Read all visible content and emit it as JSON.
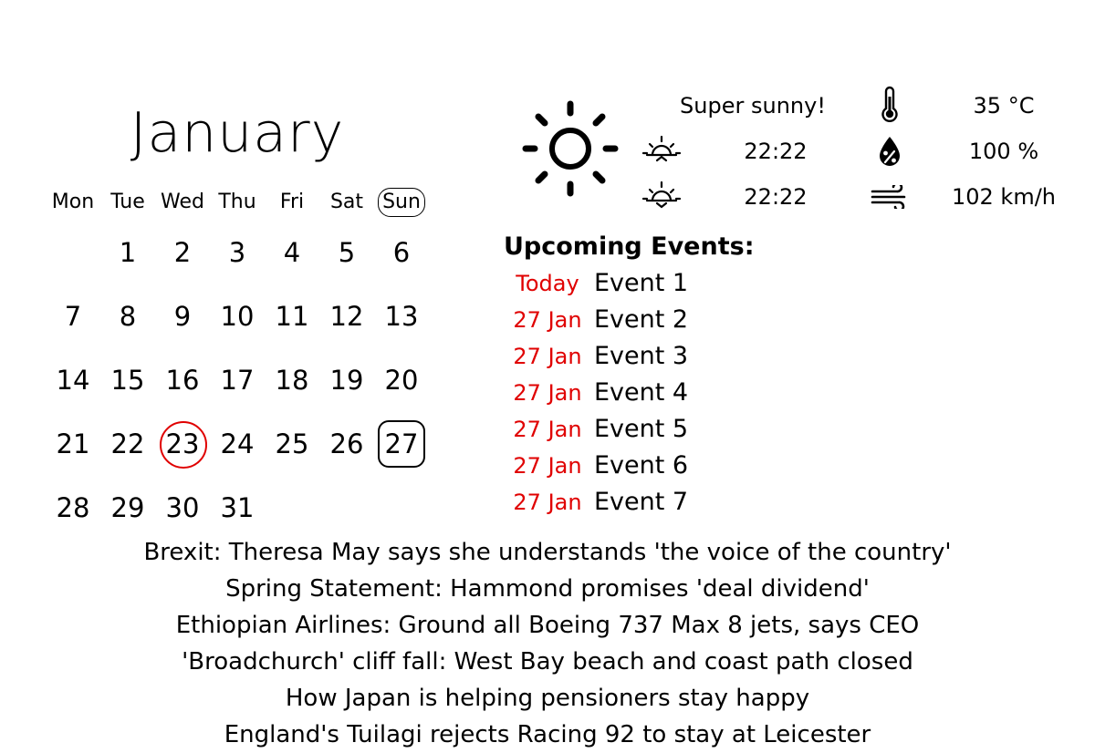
{
  "calendar": {
    "month": "January",
    "weekdays": [
      "Mon",
      "Tue",
      "Wed",
      "Thu",
      "Fri",
      "Sat",
      "Sun"
    ],
    "current_weekday_index": 6,
    "first_day_offset": 1,
    "days_in_month": 31,
    "today": 23,
    "selected": 27
  },
  "weather": {
    "condition_icon": "sun-icon",
    "description": "Super sunny!",
    "sunrise": "22:22",
    "sunset": "22:22",
    "temperature": "35 °C",
    "humidity": "100 %",
    "wind": "102 km/h",
    "icons": {
      "sunrise": "sunrise-icon",
      "sunset": "sunset-icon",
      "temperature": "thermometer-icon",
      "humidity": "humidity-drop-icon",
      "wind": "wind-icon"
    }
  },
  "events": {
    "title": "Upcoming Events:",
    "items": [
      {
        "date": "Today",
        "name": "Event 1"
      },
      {
        "date": "27 Jan",
        "name": "Event 2"
      },
      {
        "date": "27 Jan",
        "name": "Event 3"
      },
      {
        "date": "27 Jan",
        "name": "Event 4"
      },
      {
        "date": "27 Jan",
        "name": "Event 5"
      },
      {
        "date": "27 Jan",
        "name": "Event 6"
      },
      {
        "date": "27 Jan",
        "name": "Event 7"
      }
    ]
  },
  "news": {
    "headlines": [
      "Brexit: Theresa May says she understands 'the voice of the country'",
      "Spring Statement: Hammond promises 'deal dividend'",
      "Ethiopian Airlines: Ground all Boeing 737 Max 8 jets, says CEO",
      "'Broadchurch' cliff fall: West Bay beach and coast path closed",
      "How Japan is helping pensioners stay happy",
      "England's Tuilagi rejects Racing 92 to stay at Leicester"
    ]
  },
  "colors": {
    "accent": "#e00000",
    "text": "#000000",
    "background": "#ffffff"
  }
}
